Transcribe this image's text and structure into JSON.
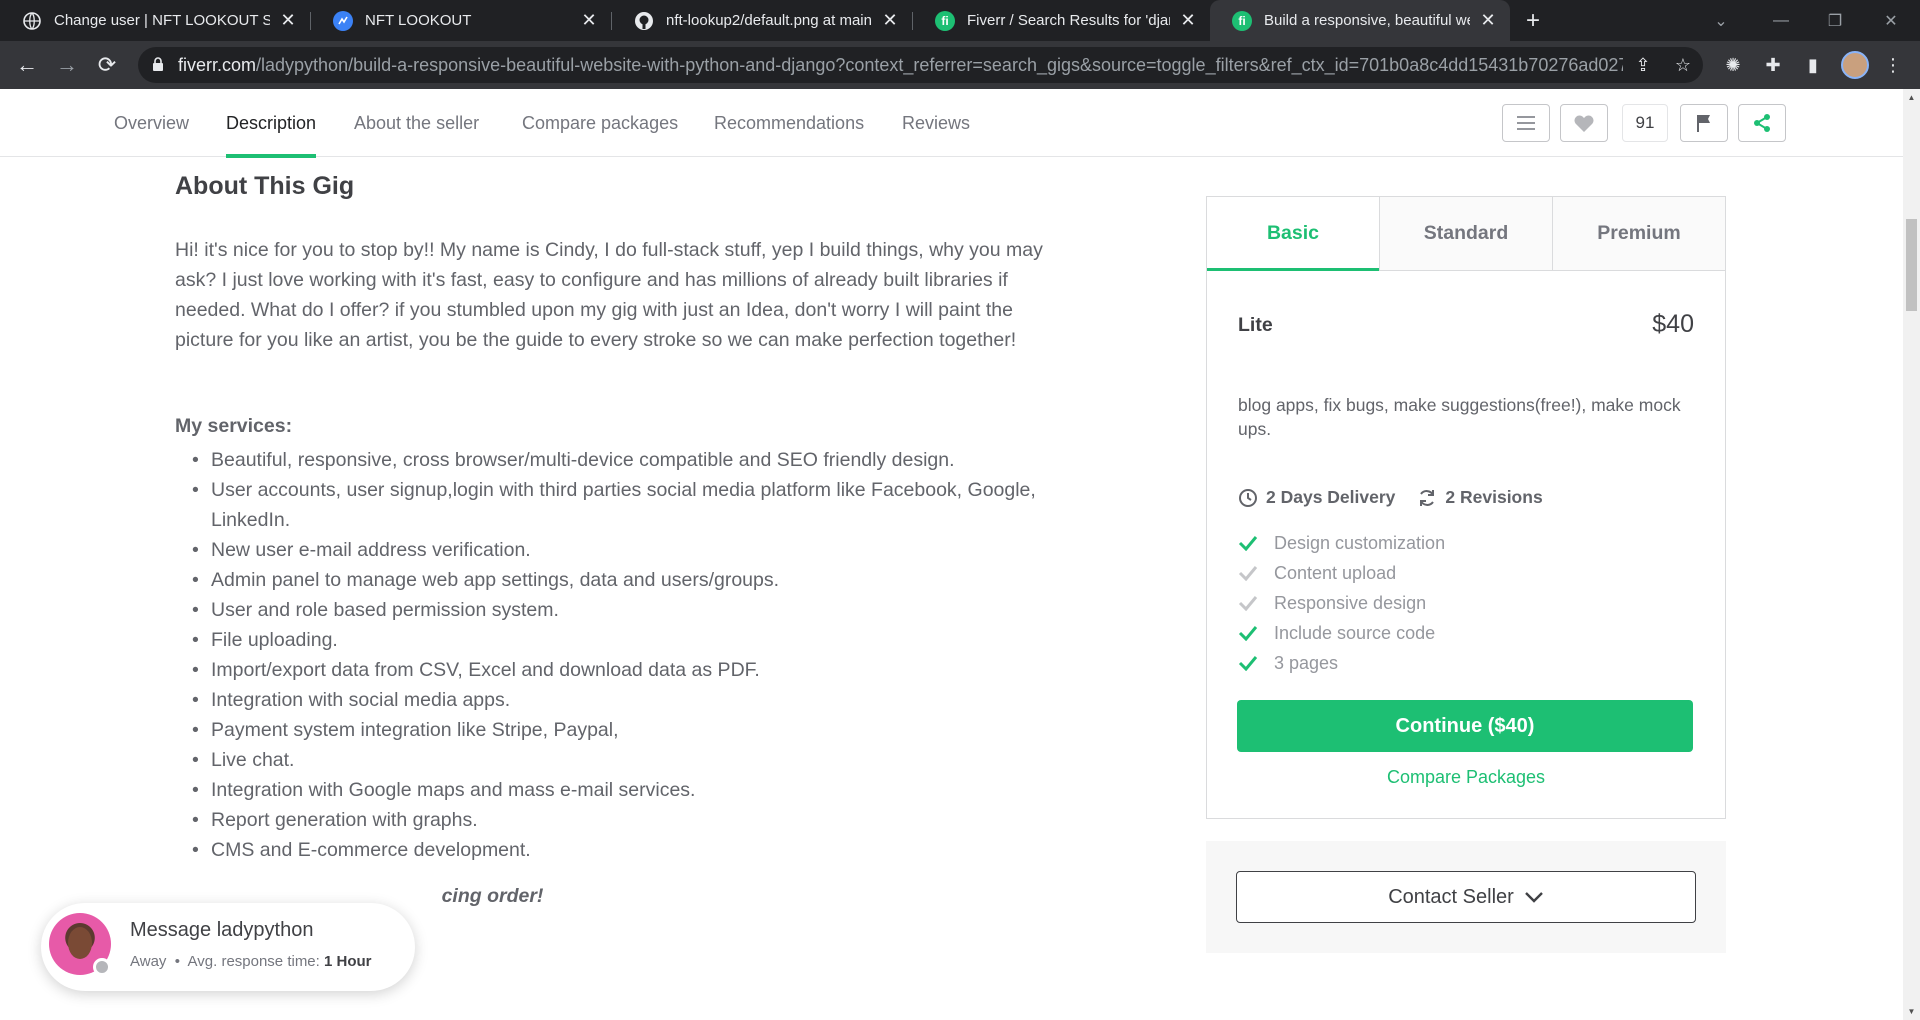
{
  "browser": {
    "tabs": [
      {
        "title": "Change user | NFT LOOKOUT Site",
        "icon": "globe-icon"
      },
      {
        "title": "NFT LOOKOUT",
        "icon": "site-icon"
      },
      {
        "title": "nft-lookup2/default.png at main",
        "icon": "github-icon"
      },
      {
        "title": "Fiverr / Search Results for 'django",
        "icon": "fiverr-icon"
      },
      {
        "title": "Build a responsive, beautiful web",
        "icon": "fiverr-icon"
      }
    ],
    "url_host": "fiverr.com",
    "url_path": "/ladypython/build-a-responsive-beautiful-website-with-python-and-django?context_referrer=search_gigs&source=toggle_filters&ref_ctx_id=701b0a8c4dd15431b70276ad027..."
  },
  "subnav": {
    "items": [
      "Overview",
      "Description",
      "About the seller",
      "Compare packages",
      "Recommendations",
      "Reviews"
    ],
    "active": "Description",
    "like_count": "91"
  },
  "about": {
    "title": "About This Gig",
    "description": "Hi! it's nice for you to stop by!! My name is Cindy, I do full-stack stuff, yep I build things, why you may ask? I just love working with it's fast, easy to configure and has millions of already built libraries if needed. What do I offer? if you stumbled upon my gig with just an Idea, don't worry I will paint the picture for you like an artist, you be the guide to every stroke so we can make perfection together!",
    "services_title": "My services:",
    "services": [
      "Beautiful, responsive, cross browser/multi-device compatible and SEO friendly design.",
      "User accounts, user signup,login with third parties social media platform like Facebook, Google, LinkedIn.",
      "New user e-mail address verification.",
      "Admin panel to manage web app settings, data and users/groups.",
      "User and role based permission system.",
      "File uploading.",
      "Import/export data from CSV, Excel and download data as PDF.",
      "Integration with social media apps.",
      "Payment system integration like Stripe, Paypal,",
      "Live chat.",
      "Integration with Google maps and mass e-mail services.",
      "Report generation with graphs.",
      "CMS and E-commerce development."
    ],
    "cut_text": "cing order!"
  },
  "package": {
    "tabs": [
      "Basic",
      "Standard",
      "Premium"
    ],
    "active_tab": "Basic",
    "name": "Lite",
    "price": "$40",
    "description": "blog apps, fix bugs, make suggestions(free!), make mock ups.",
    "delivery": "2 Days Delivery",
    "revisions": "2 Revisions",
    "features": [
      {
        "label": "Design customization",
        "included": true
      },
      {
        "label": "Content upload",
        "included": false
      },
      {
        "label": "Responsive design",
        "included": false
      },
      {
        "label": "Include source code",
        "included": true
      },
      {
        "label": "3 pages",
        "included": true
      }
    ],
    "continue_label": "Continue ($40)",
    "compare_label": "Compare Packages",
    "contact_label": "Contact Seller"
  },
  "chat": {
    "title": "Message ladypython",
    "status": "Away",
    "response_label": "Avg. response time:",
    "response_value": "1 Hour"
  },
  "colors": {
    "brand_green": "#1dbf73",
    "text_dark": "#404145",
    "text_muted": "#62646a",
    "chrome_dark": "#202124",
    "chrome_mid": "#35363a"
  }
}
